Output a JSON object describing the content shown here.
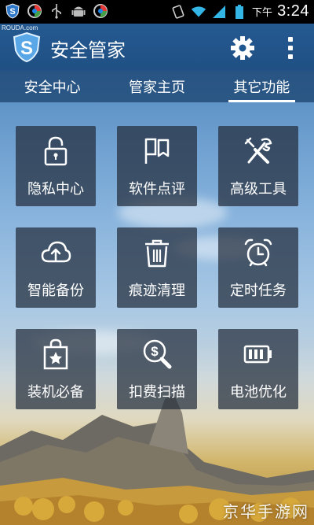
{
  "status_bar": {
    "ampm": "下午",
    "time": "3:24",
    "icons": [
      "shield-app-icon",
      "browser-icon",
      "usb-icon",
      "android-icon",
      "browser-icon",
      "vibrate-icon",
      "wifi-icon",
      "signal-icon",
      "battery-icon"
    ]
  },
  "watermark_top": "ROUDA.com",
  "header": {
    "logo_letter": "S",
    "title": "安全管家",
    "settings_icon": "gear-icon",
    "menu_icon": "overflow-menu-icon"
  },
  "tabs": [
    {
      "label": "安全中心",
      "active": false
    },
    {
      "label": "管家主页",
      "active": false
    },
    {
      "label": "其它功能",
      "active": true
    }
  ],
  "tiles": [
    {
      "label": "隐私中心",
      "icon": "lock-icon"
    },
    {
      "label": "软件点评",
      "icon": "comment-flag-icon"
    },
    {
      "label": "高级工具",
      "icon": "tools-icon"
    },
    {
      "label": "智能备份",
      "icon": "cloud-upload-icon"
    },
    {
      "label": "痕迹清理",
      "icon": "trash-icon"
    },
    {
      "label": "定时任务",
      "icon": "alarm-clock-icon"
    },
    {
      "label": "装机必备",
      "icon": "shopping-bag-star-icon"
    },
    {
      "label": "扣费扫描",
      "icon": "money-search-icon"
    },
    {
      "label": "电池优化",
      "icon": "battery-icon"
    }
  ],
  "watermark": "京华手游网"
}
